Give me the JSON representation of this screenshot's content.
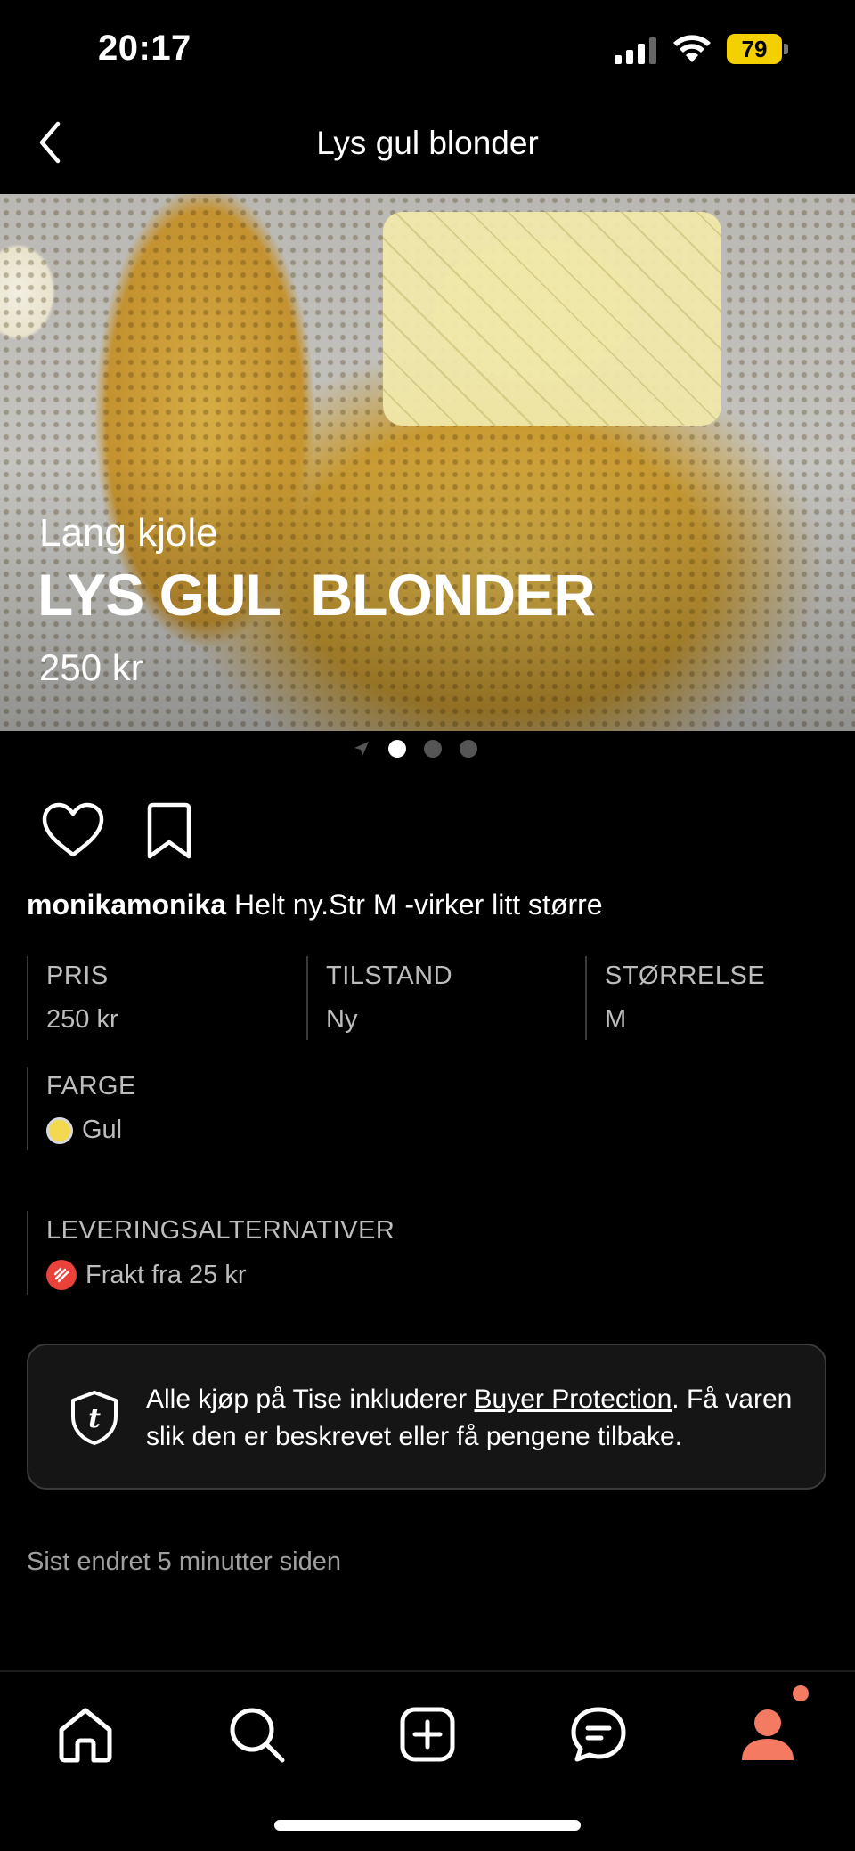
{
  "status_bar": {
    "time": "20:17",
    "battery": "79"
  },
  "header": {
    "title": "Lys gul  blonder"
  },
  "hero": {
    "subtitle": "Lang kjole",
    "title": "LYS GUL  BLONDER",
    "price": "250 kr"
  },
  "description": {
    "username": "monikamonika",
    "text": " Helt ny.Str M -virker litt større"
  },
  "attributes": {
    "price": {
      "label": "PRIS",
      "value": "250 kr"
    },
    "condition": {
      "label": "TILSTAND",
      "value": "Ny"
    },
    "size": {
      "label": "STØRRELSE",
      "value": "M"
    },
    "color": {
      "label": "FARGE",
      "value": "Gul",
      "swatch": "#f2d94e"
    },
    "delivery": {
      "label": "LEVERINGSALTERNATIVER",
      "value": "Frakt fra 25 kr"
    }
  },
  "protection": {
    "text_before": "Alle kjøp på Tise inkluderer ",
    "link": "Buyer Protection",
    "text_after": ". Få varen slik den er beskrevet eller få pengene tilbake."
  },
  "last_edited": "Sist endret 5 minutter siden",
  "icons": [
    "back-icon",
    "heart-icon",
    "bookmark-icon",
    "tise-shield-icon",
    "home-icon",
    "search-icon",
    "add-icon",
    "chat-icon",
    "profile-icon"
  ],
  "colors": {
    "accent": "#f47b62",
    "battery": "#f5d000",
    "delivery_badge": "#e8423a"
  }
}
